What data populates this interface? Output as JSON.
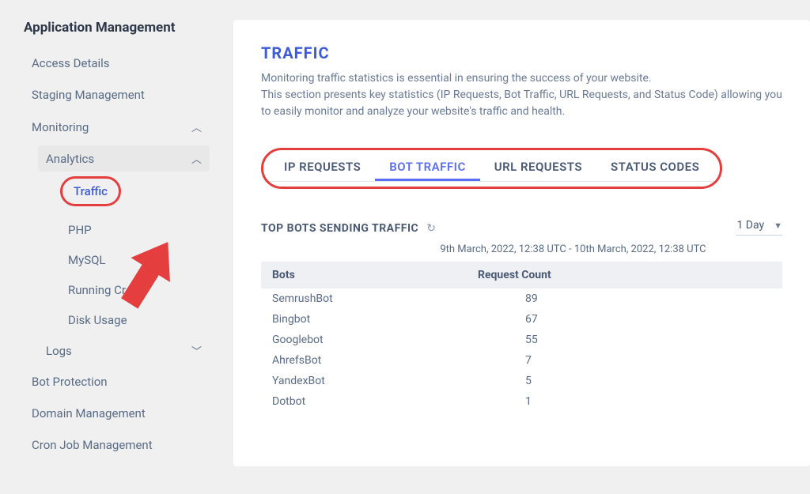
{
  "sidebar": {
    "title": "Application Management",
    "items": [
      {
        "label": "Access Details"
      },
      {
        "label": "Staging Management"
      },
      {
        "label": "Monitoring",
        "expandable": true,
        "open": true
      },
      {
        "label": "Analytics",
        "expandable": true,
        "open": true,
        "highlighted_bg": true
      },
      {
        "label": "Traffic",
        "highlighted_ring": true
      },
      {
        "label": "PHP"
      },
      {
        "label": "MySQL"
      },
      {
        "label": "Running Crons"
      },
      {
        "label": "Disk Usage"
      },
      {
        "label": "Logs",
        "expandable": true,
        "open": false
      },
      {
        "label": "Bot Protection"
      },
      {
        "label": "Domain Management"
      },
      {
        "label": "Cron Job Management"
      }
    ]
  },
  "main": {
    "title": "TRAFFIC",
    "desc_line1": "Monitoring traffic statistics is essential in ensuring the success of your website.",
    "desc_line2": "This section presents key statistics (IP Requests, Bot Traffic, URL Requests, and Status Code) allowing you to easily monitor and analyze your website's traffic and health.",
    "tabs": [
      {
        "label": "IP REQUESTS"
      },
      {
        "label": "BOT TRAFFIC",
        "active": true
      },
      {
        "label": "URL REQUESTS"
      },
      {
        "label": "STATUS CODES"
      }
    ],
    "section_title": "TOP BOTS SENDING TRAFFIC",
    "period_label": "1 Day",
    "date_range": "9th March, 2022, 12:38 UTC - 10th March, 2022, 12:38 UTC",
    "columns": {
      "col1": "Bots",
      "col2": "Request Count"
    },
    "rows": [
      {
        "bot": "SemrushBot",
        "count": "89"
      },
      {
        "bot": "Bingbot",
        "count": "67"
      },
      {
        "bot": "Googlebot",
        "count": "55"
      },
      {
        "bot": "AhrefsBot",
        "count": "7"
      },
      {
        "bot": "YandexBot",
        "count": "5"
      },
      {
        "bot": "Dotbot",
        "count": "1"
      }
    ]
  },
  "chart_data": {
    "type": "table",
    "title": "TOP BOTS SENDING TRAFFIC",
    "columns": [
      "Bots",
      "Request Count"
    ],
    "rows": [
      [
        "SemrushBot",
        89
      ],
      [
        "Bingbot",
        67
      ],
      [
        "Googlebot",
        55
      ],
      [
        "AhrefsBot",
        7
      ],
      [
        "YandexBot",
        5
      ],
      [
        "Dotbot",
        1
      ]
    ],
    "period": "1 Day",
    "range": "9th March, 2022, 12:38 UTC - 10th March, 2022, 12:38 UTC"
  }
}
